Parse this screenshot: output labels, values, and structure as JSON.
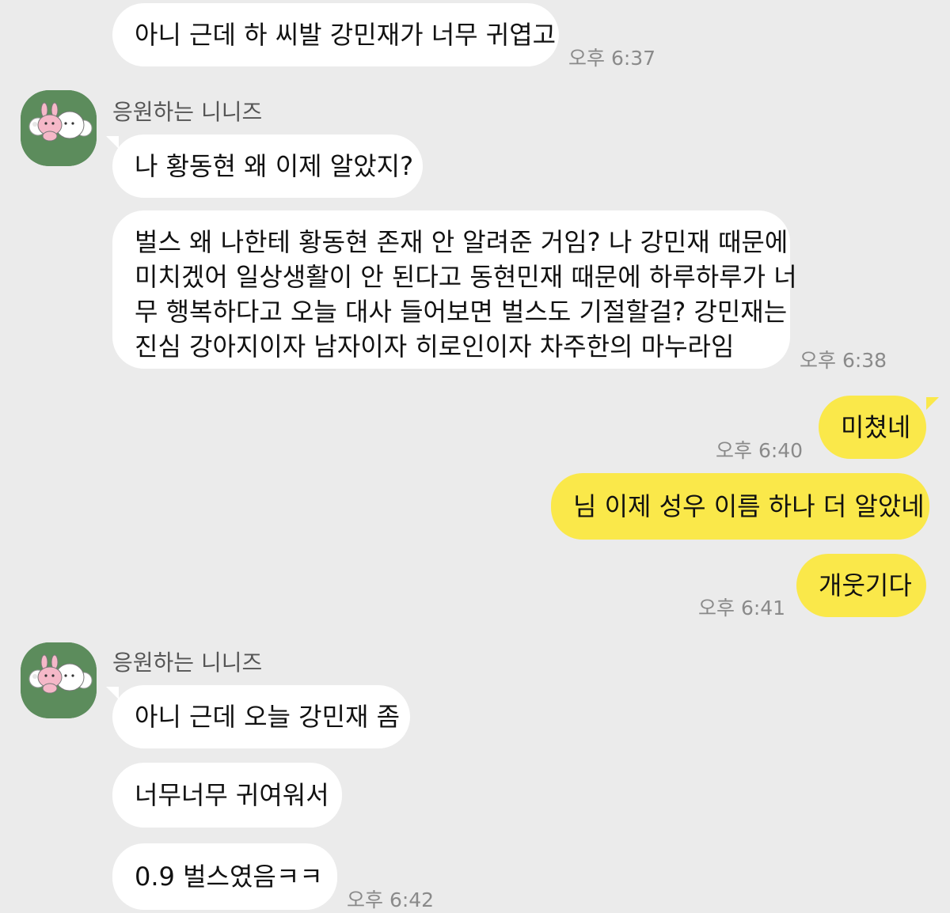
{
  "colors": {
    "background": "#ebebeb",
    "incoming_bubble": "#ffffff",
    "outgoing_bubble": "#fae84a",
    "avatar_bg": "#5c8c5c",
    "time_text": "#8a8a8a"
  },
  "messages": {
    "m1": {
      "text": "아니 근데 하 씨발 강민재가 너무 귀엽고",
      "time": "오후 6:37"
    },
    "group1_sender": "응원하는 니니즈",
    "m2": {
      "text": "나 황동현 왜 이제 알았지?"
    },
    "m3": {
      "lines": [
        "벌스 왜 나한테 황동현 존재 안 알려준 거임? 나 강민재 때문에",
        "미치겠어 일상생활이 안 된다고 동현민재 때문에 하루하루가 너",
        "무 행복하다고 오늘 대사 들어보면 벌스도 기절할걸? 강민재는",
        "진심 강아지이자 남자이자 히로인이자 차주한의 마누라임"
      ],
      "time": "오후 6:38"
    },
    "m4": {
      "text": "미쳤네",
      "time": "오후 6:40"
    },
    "m5": {
      "text": "님 이제 성우 이름 하나 더 알았네"
    },
    "m6": {
      "text": "개웃기다",
      "time": "오후 6:41"
    },
    "group2_sender": "응원하는 니니즈",
    "m7": {
      "text": "아니 근데 오늘 강민재 좀"
    },
    "m8": {
      "text": "너무너무 귀여워서"
    },
    "m9": {
      "text": "0.9 벌스였음ㅋㅋ",
      "time": "오후 6:42"
    }
  }
}
